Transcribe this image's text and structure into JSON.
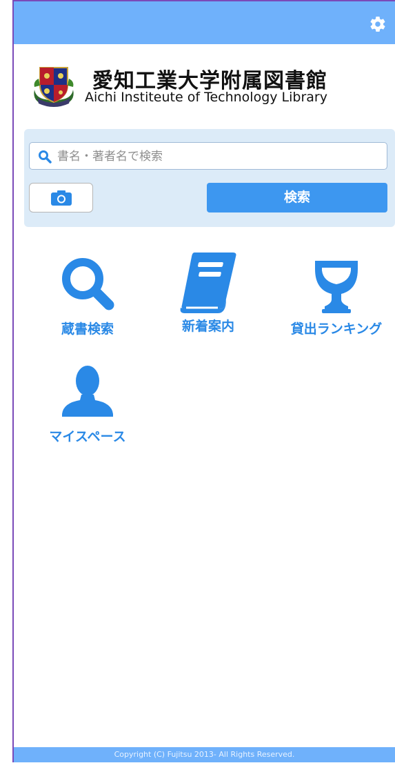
{
  "header": {
    "title_jp": "愛知工業大学附属図書館",
    "title_en": "Aichi Institeute of Technology Library",
    "logo_icon": "university-crest-icon"
  },
  "topbar": {
    "settings_icon": "gear-icon"
  },
  "search": {
    "placeholder": "書名・著者名で検索",
    "value": "",
    "button_label": "検索",
    "camera_icon": "camera-icon"
  },
  "menu": [
    {
      "label": "蔵書検索",
      "icon": "search-icon"
    },
    {
      "label": "新着案内",
      "icon": "book-icon"
    },
    {
      "label": "貸出ランキング",
      "icon": "trophy-icon"
    },
    {
      "label": "マイスペース",
      "icon": "user-icon"
    }
  ],
  "footer": {
    "copyright": "Copyright (C) Fujitsu 2013- All Rights Reserved."
  },
  "colors": {
    "accent": "#3d97f0",
    "topbar": "#6fb1fb",
    "panel": "#dcebf8",
    "menu_text": "#2a89e6"
  }
}
